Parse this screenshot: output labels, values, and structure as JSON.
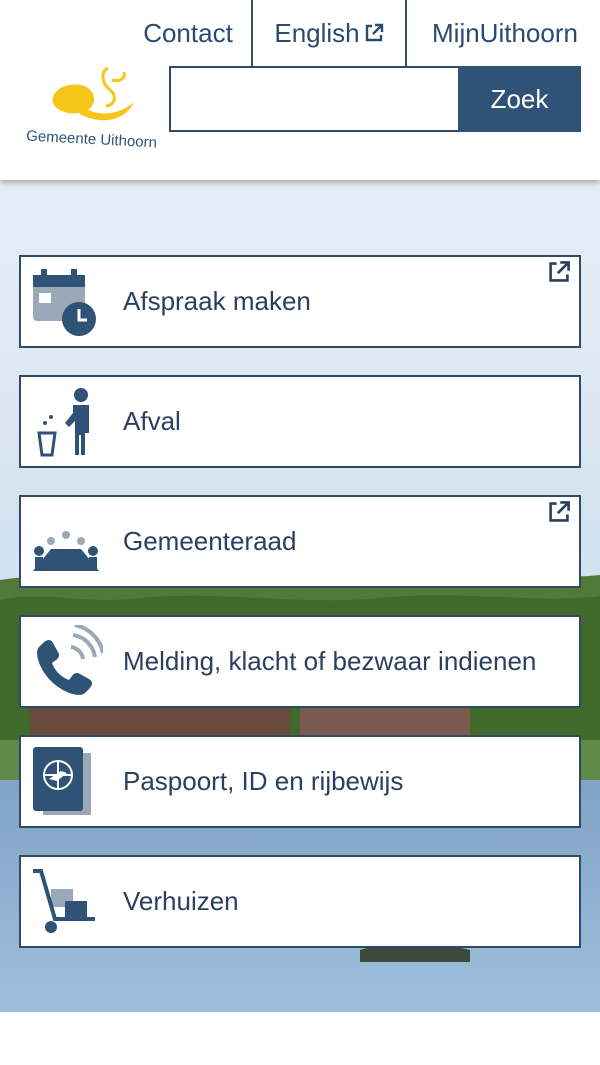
{
  "header": {
    "links": {
      "contact": "Contact",
      "english": "English",
      "mijn": "MijnUithoorn"
    },
    "logo_text": "Gemeente Uithoorn",
    "search": {
      "placeholder": "",
      "button": "Zoek"
    }
  },
  "tiles": [
    {
      "label": "Afspraak maken",
      "icon": "calendar-clock-icon",
      "external": true
    },
    {
      "label": "Afval",
      "icon": "waste-person-icon",
      "external": false
    },
    {
      "label": "Gemeenteraad",
      "icon": "council-meeting-icon",
      "external": true
    },
    {
      "label": "Melding, klacht of bezwaar indienen",
      "icon": "phone-icon",
      "external": false
    },
    {
      "label": "Paspoort, ID en rijbewijs",
      "icon": "passport-icon",
      "external": false
    },
    {
      "label": "Verhuizen",
      "icon": "hand-truck-icon",
      "external": false
    }
  ],
  "colors": {
    "primary": "#2e5377",
    "border": "#2f4a68",
    "logo_yellow": "#f5c518",
    "icon_gray": "#9aa8b8"
  }
}
